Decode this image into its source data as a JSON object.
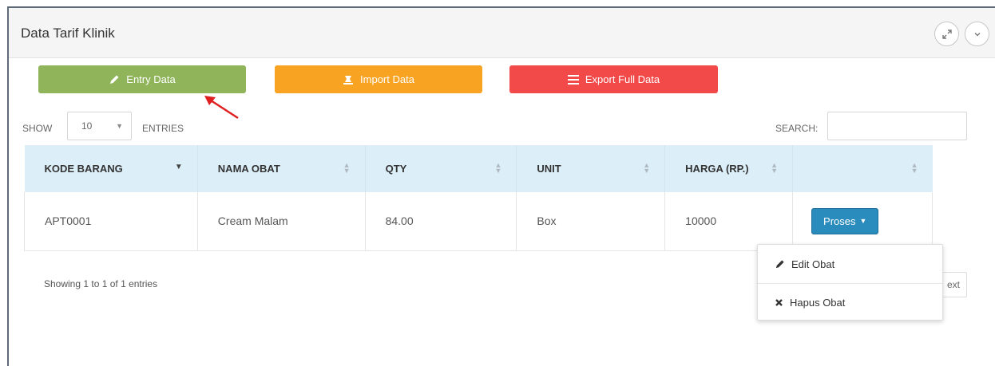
{
  "panel": {
    "title": "Data Tarif Klinik",
    "expand_icon": "expand-icon",
    "collapse_icon": "chevron-down-icon"
  },
  "toolbar": {
    "entry_label": "Entry Data",
    "entry_icon": "pencil-icon",
    "import_label": "Import Data",
    "import_icon": "import-icon",
    "export_label": "Export Full Data",
    "export_icon": "list-icon"
  },
  "length_control": {
    "show_label": "SHOW",
    "selected": "10",
    "entries_label": "ENTRIES"
  },
  "search": {
    "label": "SEARCH:",
    "value": ""
  },
  "table": {
    "columns": [
      "KODE BARANG",
      "NAMA OBAT",
      "QTY",
      "UNIT",
      "HARGA (RP.)",
      ""
    ],
    "rows": [
      {
        "kode": "APT0001",
        "nama": "Cream Malam",
        "qty": "84.00",
        "unit": "Box",
        "harga": "10000",
        "action": "Proses"
      }
    ]
  },
  "footer": {
    "info": "Showing 1 to 1 of 1 entries",
    "next_label": "ext"
  },
  "dropdown": {
    "items": [
      {
        "label": "Edit Obat",
        "icon": "pencil-icon"
      },
      {
        "label": "Hapus Obat",
        "icon": "close-icon"
      }
    ]
  },
  "colors": {
    "entry": "#8fb45a",
    "import": "#f9a323",
    "export": "#f24949",
    "proses": "#2a8bbd",
    "table_header": "#dceef8",
    "arrow": "#e02020"
  }
}
